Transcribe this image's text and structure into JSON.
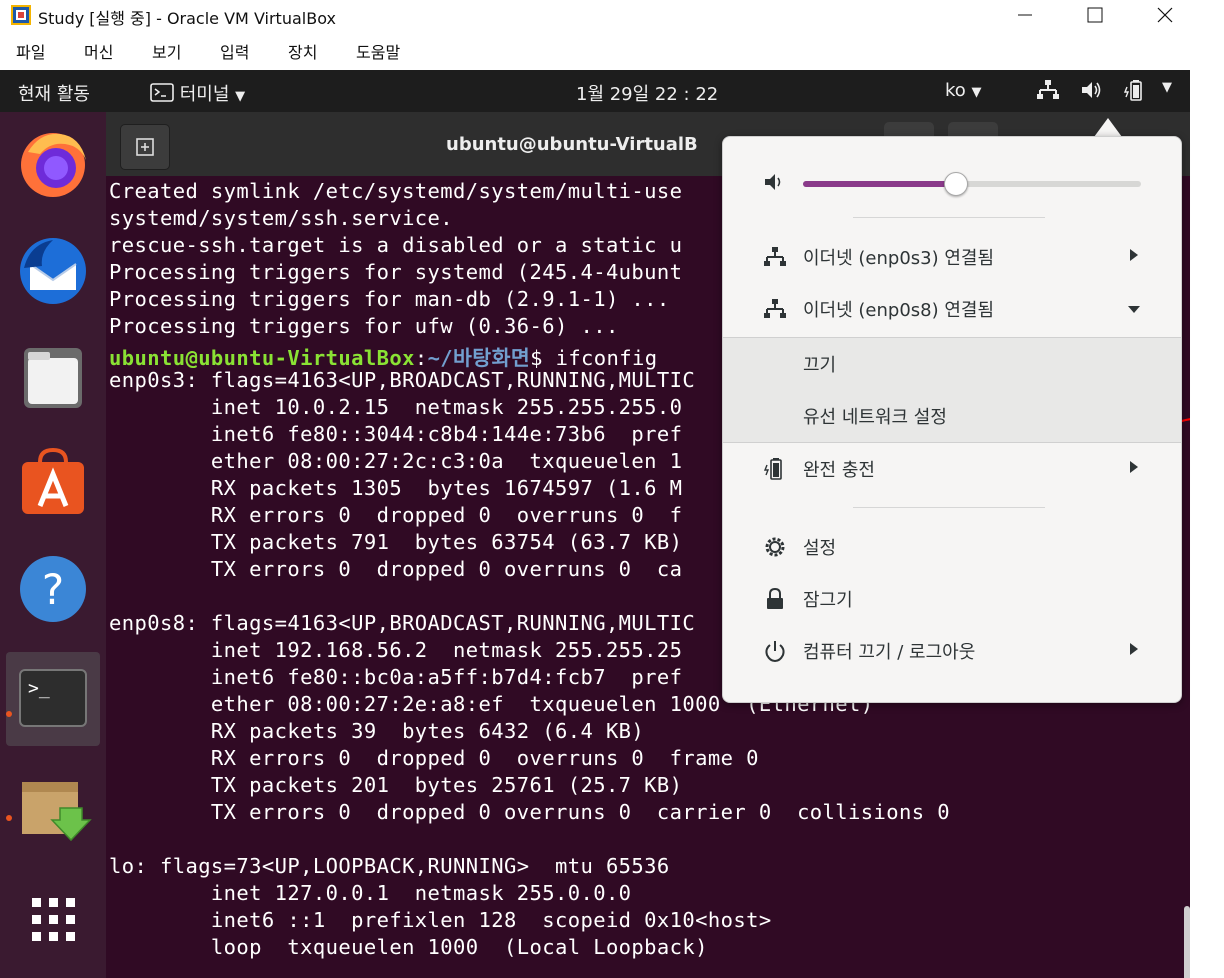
{
  "window": {
    "title": "Study [실행 중] - Oracle VM VirtualBox",
    "menu": [
      "파일",
      "머신",
      "보기",
      "입력",
      "장치",
      "도움말"
    ]
  },
  "topbar": {
    "activities": "현재 활동",
    "app_menu": "터미널",
    "clock": "1월 29일  22 : 22",
    "input_method": "ko"
  },
  "dock": {
    "items": [
      "firefox-icon",
      "thunderbird-icon",
      "files-icon",
      "software-icon",
      "help-icon",
      "terminal-icon",
      "install-icon",
      "show-apps-icon"
    ]
  },
  "terminal": {
    "title": "ubuntu@ubuntu-VirtualB",
    "lines": [
      "Created symlink /etc/systemd/system/multi-use",
      "systemd/system/ssh.service.",
      "rescue-ssh.target is a disabled or a static u",
      "Processing triggers for systemd (245.4-4ubunt",
      "Processing triggers for man-db (2.9.1-1) ...",
      "Processing triggers for ufw (0.36-6) ...",
      "",
      "enp0s3: flags=4163<UP,BROADCAST,RUNNING,MULTIC",
      "        inet 10.0.2.15  netmask 255.255.255.0",
      "        inet6 fe80::3044:c8b4:144e:73b6  pref",
      "        ether 08:00:27:2c:c3:0a  txqueuelen 1",
      "        RX packets 1305  bytes 1674597 (1.6 M",
      "        RX errors 0  dropped 0  overruns 0  f",
      "        TX packets 791  bytes 63754 (63.7 KB)",
      "        TX errors 0  dropped 0 overruns 0  ca",
      "",
      "enp0s8: flags=4163<UP,BROADCAST,RUNNING,MULTIC",
      "        inet 192.168.56.2  netmask 255.255.25",
      "        inet6 fe80::bc0a:a5ff:b7d4:fcb7  pref",
      "        ether 08:00:27:2e:a8:ef  txqueuelen 1000  (Ethernet)",
      "        RX packets 39  bytes 6432 (6.4 KB)",
      "        RX errors 0  dropped 0  overruns 0  frame 0",
      "        TX packets 201  bytes 25761 (25.7 KB)",
      "        TX errors 0  dropped 0 overruns 0  carrier 0  collisions 0",
      "",
      "lo: flags=73<UP,LOOPBACK,RUNNING>  mtu 65536",
      "        inet 127.0.0.1  netmask 255.0.0.0",
      "        inet6 ::1  prefixlen 128  scopeid 0x10<host>",
      "        loop  txqueuelen 1000  (Local Loopback)"
    ],
    "prompt_user": "ubuntu@ubuntu-VirtualBox",
    "prompt_sep": ":",
    "prompt_path": "~/바탕화면",
    "prompt_cmd": "$ ifconfig"
  },
  "sysmenu": {
    "volume": 0.45,
    "items": {
      "eth1": "이더넷 (enp0s3) 연결됨",
      "eth2": "이더넷 (enp0s8) 연결됨",
      "off": "끄기",
      "wired_settings": "유선 네트워크 설정",
      "battery": "완전 충전",
      "settings": "설정",
      "lock": "잠그기",
      "power": "컴퓨터 끄기 / 로그아웃"
    }
  },
  "colors": {
    "terminal_bg": "#300a24",
    "accent": "#e95420",
    "annotation": "#ff0000"
  }
}
